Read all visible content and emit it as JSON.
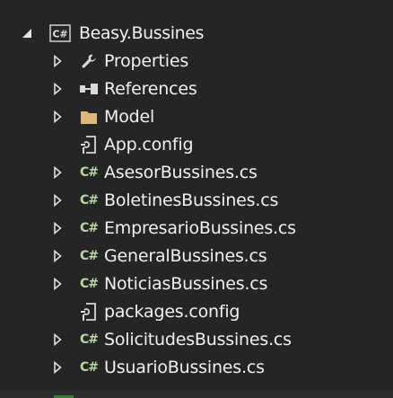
{
  "colors": {
    "background": "#252526",
    "text": "#f1f1f1",
    "arrow": "#e6e6e6",
    "cs_icon": "#b8d7a3",
    "project_icon_border": "#c8c8c8",
    "folder_icon": "#dcb67a",
    "wrench_icon": "#d9d9d9",
    "config_icon": "#d9d9d9"
  },
  "solution_explorer": {
    "root": {
      "label": "Beasy.Bussines",
      "icon": "csharp-project-icon",
      "expanded": true,
      "project_icon_text": "C#"
    },
    "items": [
      {
        "label": "Properties",
        "icon": "wrench-icon",
        "expandable": true
      },
      {
        "label": "References",
        "icon": "references-icon",
        "expandable": true
      },
      {
        "label": "Model",
        "icon": "folder-icon",
        "expandable": true
      },
      {
        "label": "App.config",
        "icon": "config-file-icon",
        "expandable": false
      },
      {
        "label": "AsesorBussines.cs",
        "icon": "csharp-file-icon",
        "expandable": true,
        "icon_text": "C#"
      },
      {
        "label": "BoletinesBussines.cs",
        "icon": "csharp-file-icon",
        "expandable": true,
        "icon_text": "C#"
      },
      {
        "label": "EmpresarioBussines.cs",
        "icon": "csharp-file-icon",
        "expandable": true,
        "icon_text": "C#"
      },
      {
        "label": "GeneralBussines.cs",
        "icon": "csharp-file-icon",
        "expandable": true,
        "icon_text": "C#"
      },
      {
        "label": "NoticiasBussines.cs",
        "icon": "csharp-file-icon",
        "expandable": true,
        "icon_text": "C#"
      },
      {
        "label": "packages.config",
        "icon": "config-file-icon",
        "expandable": false
      },
      {
        "label": "SolicitudesBussines.cs",
        "icon": "csharp-file-icon",
        "expandable": true,
        "icon_text": "C#"
      },
      {
        "label": "UsuarioBussines.cs",
        "icon": "csharp-file-icon",
        "expandable": true,
        "icon_text": "C#"
      }
    ]
  }
}
